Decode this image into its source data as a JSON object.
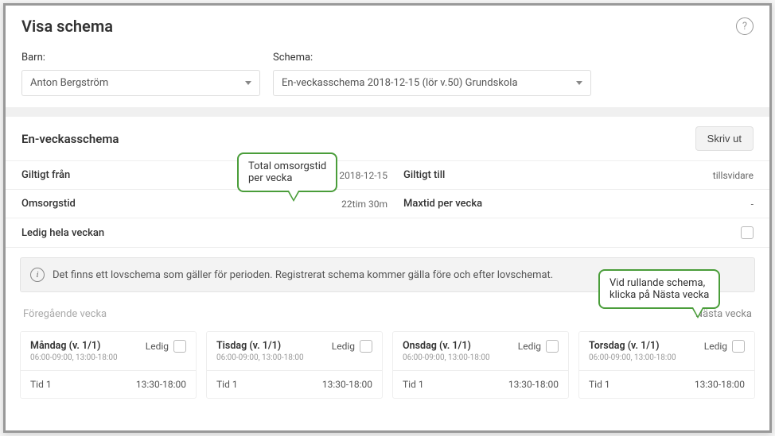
{
  "header": {
    "title": "Visa schema"
  },
  "filters": {
    "barn_label": "Barn:",
    "barn_value": "Anton Bergström",
    "schema_label": "Schema:",
    "schema_value": "En-veckasschema 2018-12-15 (lör v.50) Grundskola"
  },
  "schedule": {
    "title": "En-veckasschema",
    "print": "Skriv ut",
    "from_label": "Giltigt från",
    "from_value": "2018-12-15",
    "to_label": "Giltigt till",
    "to_value": "tillsvidare",
    "care_label": "Omsorgstid",
    "care_value": "22tim 30m",
    "max_label": "Maxtid per vecka",
    "max_value": "-",
    "ledig_label": "Ledig hela veckan"
  },
  "notice": "Det finns ett lovschema som gäller för perioden. Registrerat schema kommer gälla före och efter lovschemat.",
  "nav": {
    "prev": "Föregående vecka",
    "next": "Nästa vecka"
  },
  "days": [
    {
      "title": "Måndag (v. 1/1)",
      "sub": "06:00-09:00, 13:00-18:00",
      "time_label": "Tid 1",
      "time_value": "13:30-18:00",
      "ledig": "Ledig"
    },
    {
      "title": "Tisdag (v. 1/1)",
      "sub": "06:00-09:00, 13:00-18:00",
      "time_label": "Tid 1",
      "time_value": "13:30-18:00",
      "ledig": "Ledig"
    },
    {
      "title": "Onsdag (v. 1/1)",
      "sub": "06:00-09:00, 13:00-18:00",
      "time_label": "Tid 1",
      "time_value": "13:30-18:00",
      "ledig": "Ledig"
    },
    {
      "title": "Torsdag (v. 1/1)",
      "sub": "06:00-09:00, 13:00-18:00",
      "time_label": "Tid 1",
      "time_value": "13:30-18:00",
      "ledig": "Ledig"
    }
  ],
  "callouts": {
    "c1_line1": "Total omsorgstid",
    "c1_line2": "per vecka",
    "c2_line1": "Vid rullande schema,",
    "c2_line2": "klicka på Nästa vecka"
  }
}
